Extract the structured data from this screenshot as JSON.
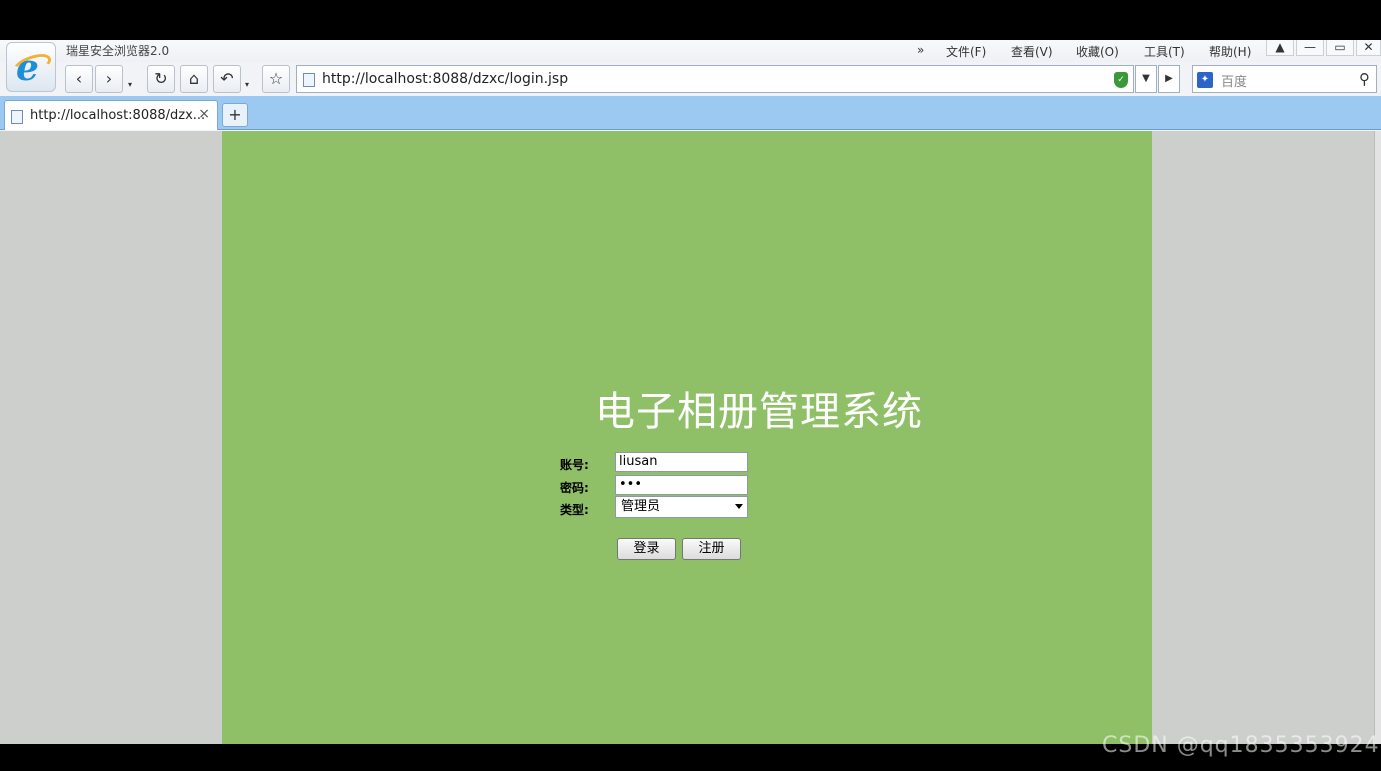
{
  "browser": {
    "title": "瑞星安全浏览器2.0",
    "menu_chevron": "»",
    "menu": [
      "文件(F)",
      "查看(V)",
      "收藏(O)",
      "工具(T)",
      "帮助(H)"
    ],
    "url": "http://localhost:8088/dzxc/login.jsp",
    "search_placeholder": "百度",
    "tab_label": "http://localhost:8088/dzx...",
    "tab_close": "×",
    "new_tab": "+"
  },
  "page": {
    "background_color": "#8fc068",
    "title": "电子相册管理系统",
    "account_label": "账号:",
    "account_value": "liusan",
    "password_label": "密码:",
    "password_value": "•••",
    "type_label": "类型:",
    "type_selected": "管理员",
    "login_button": "登录",
    "register_button": "注册"
  },
  "watermark": "CSDN @qq1835353924"
}
